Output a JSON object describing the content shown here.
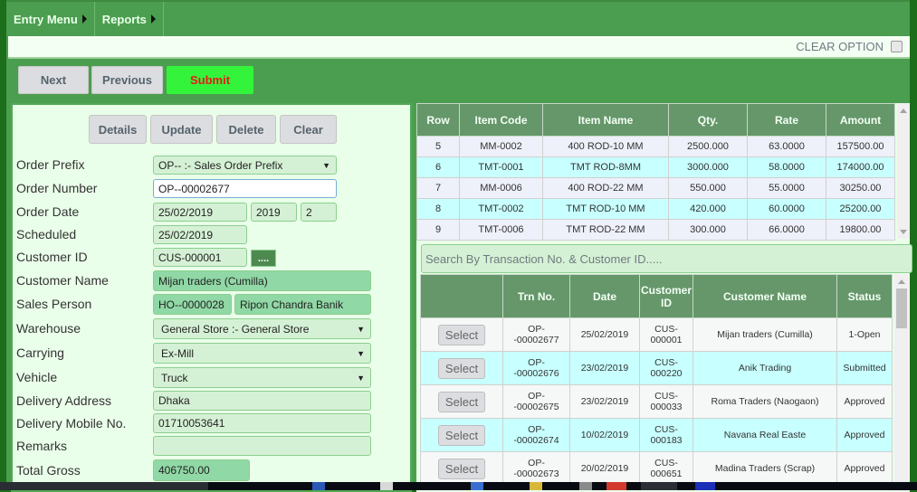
{
  "topmenu": [
    {
      "label": "Entry Menu"
    },
    {
      "label": "Reports"
    }
  ],
  "options": {
    "clear_option_label": "CLEAR OPTION",
    "clear_option_checked": false
  },
  "nav": {
    "next": "Next",
    "previous": "Previous",
    "submit": "Submit"
  },
  "actions": {
    "details": "Details",
    "update": "Update",
    "delete": "Delete",
    "clear": "Clear"
  },
  "form": {
    "order_prefix": {
      "label": "Order Prefix",
      "value": "OP-- :- Sales Order Prefix"
    },
    "order_number": {
      "label": "Order Number",
      "value": "OP--00002677"
    },
    "order_date": {
      "label": "Order Date",
      "value": "25/02/2019",
      "year": "2019",
      "month": "2"
    },
    "scheduled": {
      "label": "Scheduled",
      "value": "25/02/2019"
    },
    "customer_id": {
      "label": "Customer ID",
      "value": "CUS-000001",
      "lookup_label": "...."
    },
    "customer_name": {
      "label": "Customer Name",
      "value": "Mijan traders  (Cumilla)"
    },
    "sales_person": {
      "label": "Sales Person",
      "code": "HO--0000028",
      "name": "Ripon Chandra Banik"
    },
    "warehouse": {
      "label": "Warehouse",
      "value": "General Store :- General Store"
    },
    "carrying": {
      "label": "Carrying",
      "value": "Ex-Mill"
    },
    "vehicle": {
      "label": "Vehicle",
      "value": "Truck"
    },
    "delivery_address": {
      "label": "Delivery Address",
      "value": "Dhaka"
    },
    "delivery_mobile": {
      "label": "Delivery Mobile No.",
      "value": "01710053641"
    },
    "remarks": {
      "label": "Remarks",
      "value": ""
    },
    "total_gross": {
      "label": "Total Gross",
      "value": "406750.00"
    }
  },
  "items": {
    "headers": [
      "Row",
      "Item Code",
      "Item Name",
      "Qty.",
      "Rate",
      "Amount"
    ],
    "rows": [
      [
        "5",
        "MM-0002",
        "400 ROD-10 MM",
        "2500.000",
        "63.0000",
        "157500.00"
      ],
      [
        "6",
        "TMT-0001",
        "TMT ROD-8MM",
        "3000.000",
        "58.0000",
        "174000.00"
      ],
      [
        "7",
        "MM-0006",
        "400 ROD-22 MM",
        "550.000",
        "55.0000",
        "30250.00"
      ],
      [
        "8",
        "TMT-0002",
        "TMT ROD-10 MM",
        "420.000",
        "60.0000",
        "25200.00"
      ],
      [
        "9",
        "TMT-0006",
        "TMT ROD-22 MM",
        "300.000",
        "66.0000",
        "19800.00"
      ]
    ]
  },
  "search": {
    "placeholder": "Search By Transaction No. & Customer ID....."
  },
  "orders": {
    "headers": [
      "",
      "Trn No.",
      "Date",
      "Customer ID",
      "Customer Name",
      "Status"
    ],
    "select_label": "Select",
    "rows": [
      {
        "trn": "OP--00002677",
        "date": "25/02/2019",
        "cust_id": "CUS-000001",
        "name": "Mijan traders (Cumilla)",
        "status": "1-Open"
      },
      {
        "trn": "OP--00002676",
        "date": "23/02/2019",
        "cust_id": "CUS-000220",
        "name": "Anik Trading",
        "status": "Submitted"
      },
      {
        "trn": "OP--00002675",
        "date": "23/02/2019",
        "cust_id": "CUS-000033",
        "name": "Roma Traders (Naogaon)",
        "status": "Approved"
      },
      {
        "trn": "OP--00002674",
        "date": "10/02/2019",
        "cust_id": "CUS-000183",
        "name": "Navana Real Easte",
        "status": "Approved"
      },
      {
        "trn": "OP--00002673",
        "date": "20/02/2019",
        "cust_id": "CUS-000651",
        "name": "Madina Traders (Scrap)",
        "status": "Approved"
      }
    ]
  },
  "colors": {
    "brand_green": "#4b9e4f",
    "header_green": "#65976a",
    "submit_bg": "#33f43a",
    "submit_text": "#e8191b"
  }
}
